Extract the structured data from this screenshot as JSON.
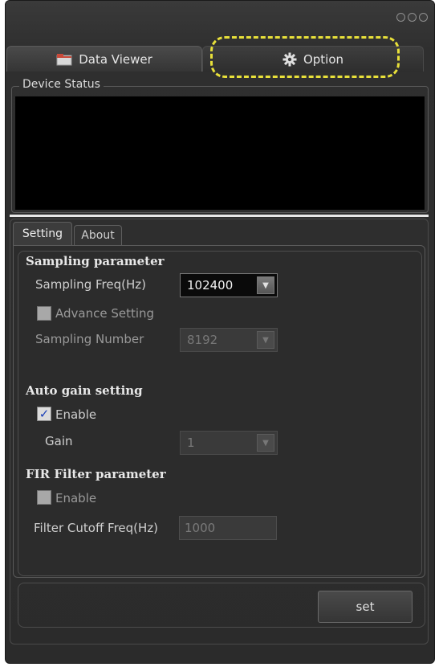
{
  "window": {
    "controls": [
      "minimize-icon",
      "maximize-icon",
      "close-icon"
    ]
  },
  "tabs": [
    {
      "label": "Data Viewer",
      "icon": "folder-icon"
    },
    {
      "label": "Option",
      "icon": "gear-icon",
      "selected": true
    }
  ],
  "device_status": {
    "title": "Device Status"
  },
  "subtabs": [
    {
      "label": "Setting",
      "selected": true
    },
    {
      "label": "About"
    }
  ],
  "sampling": {
    "title": "Sampling parameter",
    "freq_label": "Sampling Freq(Hz)",
    "freq_value": "102400",
    "advance_label": "Advance Setting",
    "advance_checked": false,
    "number_label": "Sampling Number",
    "number_value": "8192"
  },
  "auto_gain": {
    "title": "Auto gain setting",
    "enable_label": "Enable",
    "enable_checked": true,
    "gain_label": "Gain",
    "gain_value": "1"
  },
  "fir": {
    "title": "FIR Filter parameter",
    "enable_label": "Enable",
    "enable_checked": false,
    "cutoff_label": "Filter Cutoff Freq(Hz)",
    "cutoff_value": "1000"
  },
  "actions": {
    "set_label": "set"
  },
  "colors": {
    "highlight": "#e8e03a",
    "background": "#2b2b2b",
    "check_mark": "#1a3fb8"
  }
}
